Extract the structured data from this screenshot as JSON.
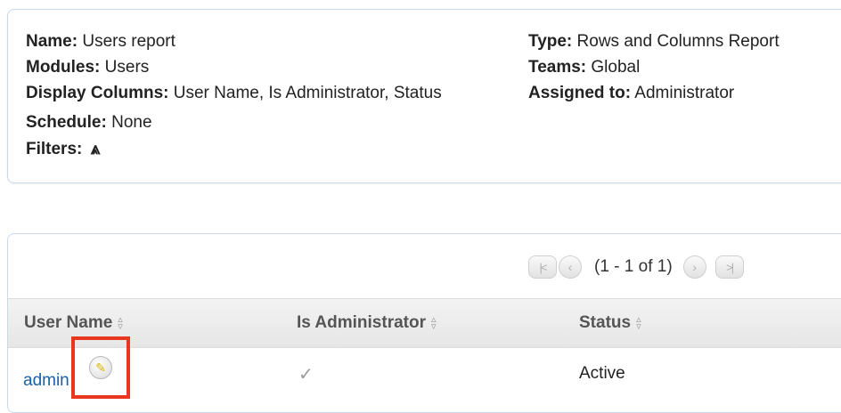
{
  "report_info": {
    "name_label": "Name:",
    "name_value": "Users report",
    "modules_label": "Modules:",
    "modules_value": "Users",
    "display_columns_label": "Display Columns:",
    "display_columns_value": "User Name, Is Administrator, Status",
    "schedule_label": "Schedule:",
    "schedule_value": "None",
    "filters_label": "Filters:",
    "filters_toggle_icon": "⩓",
    "type_label": "Type:",
    "type_value": "Rows and Columns Report",
    "teams_label": "Teams:",
    "teams_value": "Global",
    "assigned_label": "Assigned to:",
    "assigned_value": "Administrator"
  },
  "pagination": {
    "first_icon": "|<",
    "prev_icon": "‹",
    "text": "(1 - 1 of 1)",
    "next_icon": "›",
    "last_icon": ">|"
  },
  "table": {
    "columns": [
      "User Name",
      "Is Administrator",
      "Status"
    ],
    "rows": [
      {
        "user_name": "admin",
        "is_administrator": "✓",
        "status": "Active"
      }
    ]
  },
  "icons": {
    "sort": "sort-icon",
    "edit": "pencil-icon",
    "check": "checkmark-icon"
  },
  "colors": {
    "link": "#1a5fa8",
    "highlight": "#e8371f",
    "panel_border": "#c9d9ea"
  }
}
